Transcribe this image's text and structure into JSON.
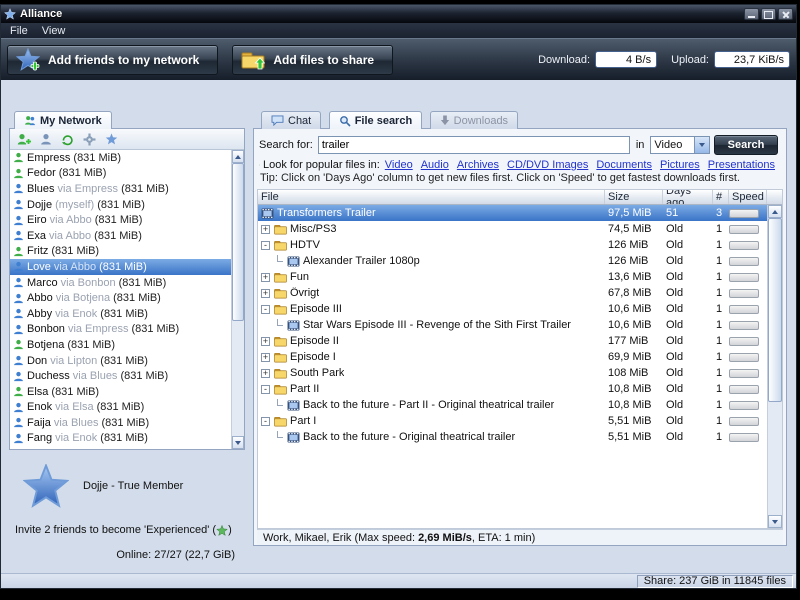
{
  "window": {
    "title": "Alliance",
    "menu": [
      "File",
      "View"
    ]
  },
  "toolbar": {
    "add_friends_label": "Add friends to my network",
    "add_files_label": "Add files to share",
    "download_label": "Download:",
    "download_value": "4 B/s",
    "upload_label": "Upload:",
    "upload_value": "23,7 KiB/s"
  },
  "left_panel": {
    "tab": "My Network",
    "toolbar_icons": [
      "add-friend-icon",
      "user-icon",
      "refresh-icon",
      "settings-gear-icon",
      "network-icon"
    ],
    "users": [
      {
        "name": "Empress",
        "via": "",
        "size": "(831 MiB)",
        "color": "#3fae49",
        "selected": false
      },
      {
        "name": "Fedor",
        "via": "",
        "size": "(831 MiB)",
        "color": "#3fae49",
        "selected": false
      },
      {
        "name": "Blues",
        "via": "via Empress",
        "size": "(831 MiB)",
        "color": "#3f7fd2",
        "selected": false
      },
      {
        "name": "Dojje",
        "via": "(myself)",
        "size": "(831 MiB)",
        "color": "#3f7fd2",
        "selected": false
      },
      {
        "name": "Eiro",
        "via": "via Abbo",
        "size": "(831 MiB)",
        "color": "#3f7fd2",
        "selected": false
      },
      {
        "name": "Exa",
        "via": "via Abbo",
        "size": "(831 MiB)",
        "color": "#3f7fd2",
        "selected": false
      },
      {
        "name": "Fritz",
        "via": "",
        "size": "(831 MiB)",
        "color": "#3fae49",
        "selected": false
      },
      {
        "name": "Love",
        "via": "via Abbo",
        "size": "(831 MiB)",
        "color": "#3f7fd2",
        "selected": true
      },
      {
        "name": "Marco",
        "via": "via Bonbon",
        "size": "(831 MiB)",
        "color": "#3f7fd2",
        "selected": false
      },
      {
        "name": "Abbo",
        "via": "via Botjena",
        "size": "(831 MiB)",
        "color": "#3f7fd2",
        "selected": false
      },
      {
        "name": "Abby",
        "via": "via Enok",
        "size": "(831 MiB)",
        "color": "#3f7fd2",
        "selected": false
      },
      {
        "name": "Bonbon",
        "via": "via Empress",
        "size": "(831 MiB)",
        "color": "#3f7fd2",
        "selected": false
      },
      {
        "name": "Botjena",
        "via": "",
        "size": "(831 MiB)",
        "color": "#3fae49",
        "selected": false
      },
      {
        "name": "Don",
        "via": "via Lipton",
        "size": "(831 MiB)",
        "color": "#3f7fd2",
        "selected": false
      },
      {
        "name": "Duchess",
        "via": "via Blues",
        "size": "(831 MiB)",
        "color": "#3f7fd2",
        "selected": false
      },
      {
        "name": "Elsa",
        "via": "",
        "size": "(831 MiB)",
        "color": "#3fae49",
        "selected": false
      },
      {
        "name": "Enok",
        "via": "via Elsa",
        "size": "(831 MiB)",
        "color": "#3f7fd2",
        "selected": false
      },
      {
        "name": "Faija",
        "via": "via Blues",
        "size": "(831 MiB)",
        "color": "#3f7fd2",
        "selected": false
      },
      {
        "name": "Fang",
        "via": "via Enok",
        "size": "(831 MiB)",
        "color": "#3f7fd2",
        "selected": false
      }
    ],
    "footer": {
      "member": "Dojje  - True Member",
      "invite_prefix": "Invite 2 friends to become 'Experienced' (",
      "invite_suffix": ")",
      "online": "Online: 27/27 (22,7 GiB)"
    }
  },
  "right_panel": {
    "tabs": [
      {
        "label": "Chat",
        "active": false
      },
      {
        "label": "File search",
        "active": true
      },
      {
        "label": "Downloads",
        "active": false
      }
    ],
    "search": {
      "label": "Search for:",
      "value": "trailer",
      "in_label": "in",
      "category": "Video",
      "button": "Search"
    },
    "popular": {
      "label": "Look for popular files in:",
      "links": [
        "Video",
        "Audio",
        "Archives",
        "CD/DVD Images",
        "Documents",
        "Pictures",
        "Presentations"
      ]
    },
    "tip": "Tip: Click on 'Days Ago' column to get new files first. Click on 'Speed' to get fastest downloads first.",
    "table": {
      "columns": [
        "File",
        "Size",
        "Days ago",
        "#",
        "Speed"
      ],
      "rows": [
        {
          "name": "Transformers Trailer",
          "size": "97,5 MiB",
          "days": "51",
          "count": "3",
          "kind": "file",
          "level": 0,
          "expand": "",
          "selected": true
        },
        {
          "name": "Misc/PS3",
          "size": "74,5 MiB",
          "days": "Old",
          "count": "1",
          "kind": "folder",
          "level": 0,
          "expand": "+",
          "selected": false
        },
        {
          "name": "HDTV",
          "size": "126 MiB",
          "days": "Old",
          "count": "1",
          "kind": "folder",
          "level": 0,
          "expand": "-",
          "selected": false
        },
        {
          "name": "Alexander Trailer 1080p",
          "size": "126 MiB",
          "days": "Old",
          "count": "1",
          "kind": "file",
          "level": 1,
          "expand": "",
          "selected": false
        },
        {
          "name": "Fun",
          "size": "13,6 MiB",
          "days": "Old",
          "count": "1",
          "kind": "folder",
          "level": 0,
          "expand": "+",
          "selected": false
        },
        {
          "name": "Övrigt",
          "size": "67,8 MiB",
          "days": "Old",
          "count": "1",
          "kind": "folder",
          "level": 0,
          "expand": "+",
          "selected": false
        },
        {
          "name": "Episode III",
          "size": "10,6 MiB",
          "days": "Old",
          "count": "1",
          "kind": "folder",
          "level": 0,
          "expand": "-",
          "selected": false
        },
        {
          "name": "Star Wars Episode III - Revenge of the Sith First Trailer",
          "size": "10,6 MiB",
          "days": "Old",
          "count": "1",
          "kind": "file",
          "level": 1,
          "expand": "",
          "selected": false
        },
        {
          "name": "Episode II",
          "size": "177 MiB",
          "days": "Old",
          "count": "1",
          "kind": "folder",
          "level": 0,
          "expand": "+",
          "selected": false
        },
        {
          "name": "Episode I",
          "size": "69,9 MiB",
          "days": "Old",
          "count": "1",
          "kind": "folder",
          "level": 0,
          "expand": "+",
          "selected": false
        },
        {
          "name": "South Park",
          "size": "108 MiB",
          "days": "Old",
          "count": "1",
          "kind": "folder",
          "level": 0,
          "expand": "+",
          "selected": false
        },
        {
          "name": "Part II",
          "size": "10,8 MiB",
          "days": "Old",
          "count": "1",
          "kind": "folder",
          "level": 0,
          "expand": "-",
          "selected": false
        },
        {
          "name": "Back to the future - Part II - Original theatrical trailer",
          "size": "10,8 MiB",
          "days": "Old",
          "count": "1",
          "kind": "file",
          "level": 1,
          "expand": "",
          "selected": false
        },
        {
          "name": "Part I",
          "size": "5,51 MiB",
          "days": "Old",
          "count": "1",
          "kind": "folder",
          "level": 0,
          "expand": "-",
          "selected": false
        },
        {
          "name": "Back to the future - Original theatrical trailer",
          "size": "5,51 MiB",
          "days": "Old",
          "count": "1",
          "kind": "file",
          "level": 1,
          "expand": "",
          "selected": false
        }
      ]
    },
    "status": {
      "prefix": "Work, Mikael, Erik (Max speed: ",
      "speed": "2,69 MiB/s",
      "suffix": ", ETA: 1 min)"
    }
  },
  "statusbar": {
    "share": "Share: 237 GiB in 11845 files"
  }
}
